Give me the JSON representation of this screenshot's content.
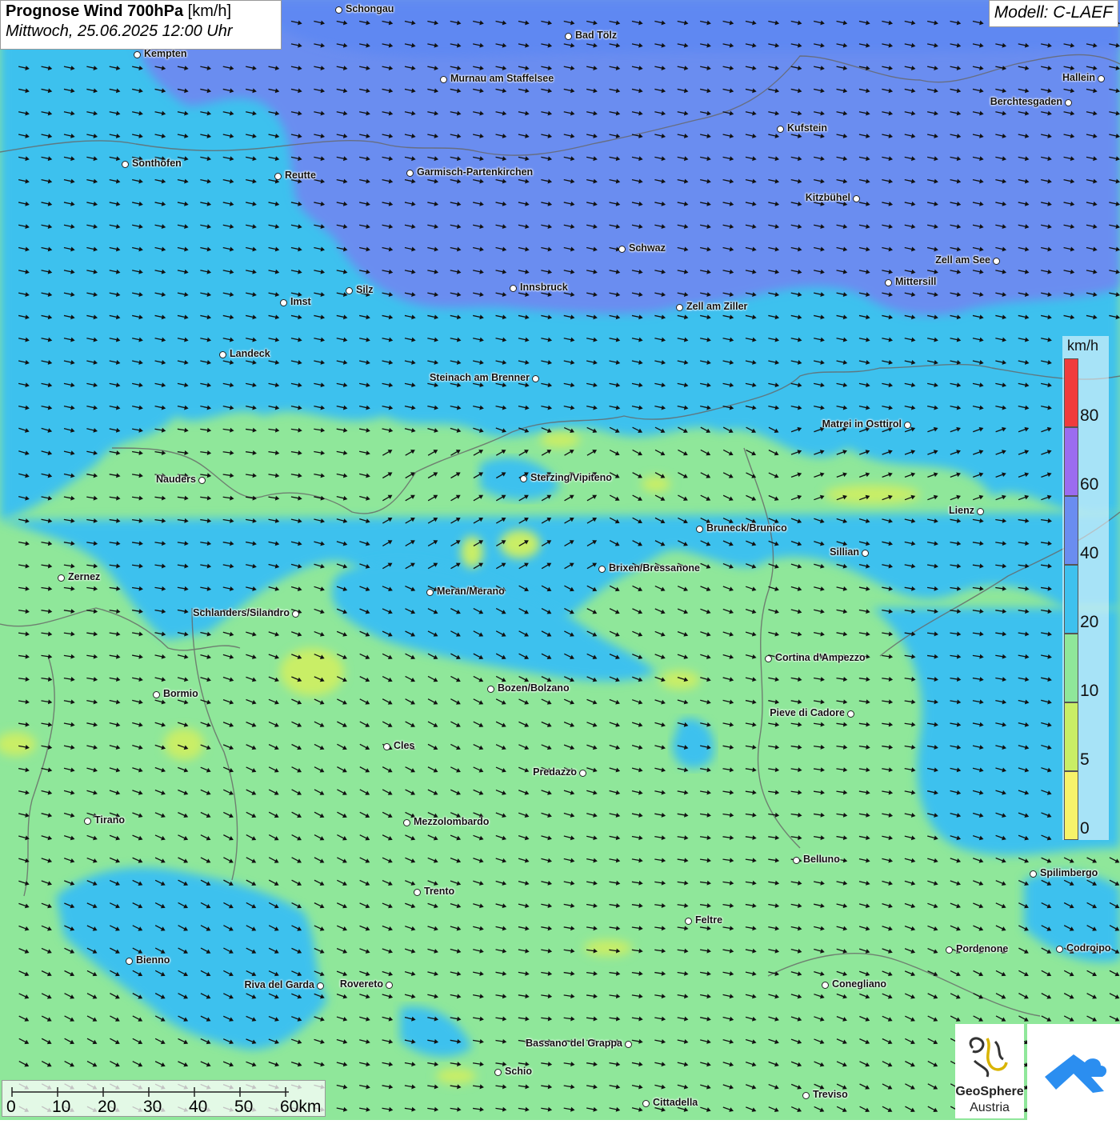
{
  "header": {
    "title_bold": "Prognose Wind 700hPa",
    "title_unit": "[km/h]",
    "datetime": "Mittwoch, 25.06.2025 12:00 Uhr",
    "model": "Modell: C-LAEF"
  },
  "legend": {
    "unit": "km/h",
    "bands": [
      {
        "label": "0",
        "color": "#f7f36a"
      },
      {
        "label": "5",
        "color": "#c9ee66"
      },
      {
        "label": "10",
        "color": "#8fe79a"
      },
      {
        "label": "20",
        "color": "#3ec1ee"
      },
      {
        "label": "40",
        "color": "#6a8df0"
      },
      {
        "label": "60",
        "color": "#9b6cf0"
      },
      {
        "label": "80",
        "color": "#f03c3c"
      }
    ]
  },
  "scale": {
    "labels": [
      "0",
      "10",
      "20",
      "30",
      "40",
      "50",
      "60km"
    ]
  },
  "logo": {
    "line1": "GeoSphere",
    "line2": "Austria"
  },
  "colors": {
    "wind_very_weak": "#c9ee66",
    "wind_weak": "#8fe79a",
    "wind_moderate": "#3ec1ee",
    "wind_strong": "#6a8df0",
    "border": "#666666"
  },
  "cities": [
    {
      "name": "Schongau"
    },
    {
      "name": "Bad Tölz"
    },
    {
      "name": "Kempten"
    },
    {
      "name": "Murnau am Staffelsee"
    },
    {
      "name": "Hallein"
    },
    {
      "name": "Berchtesgaden"
    },
    {
      "name": "Kufstein"
    },
    {
      "name": "Sonthofen"
    },
    {
      "name": "Reutte"
    },
    {
      "name": "Garmisch-Partenkirchen"
    },
    {
      "name": "Kitzbühel"
    },
    {
      "name": "Schwaz"
    },
    {
      "name": "Zell am See"
    },
    {
      "name": "Mittersill"
    },
    {
      "name": "Innsbruck"
    },
    {
      "name": "Silz"
    },
    {
      "name": "Imst"
    },
    {
      "name": "Zell am Ziller"
    },
    {
      "name": "Landeck"
    },
    {
      "name": "Steinach am Brenner"
    },
    {
      "name": "Matrei in Osttirol"
    },
    {
      "name": "Nauders"
    },
    {
      "name": "Sterzing/Vipiteno"
    },
    {
      "name": "Lienz"
    },
    {
      "name": "Bruneck/Brunico"
    },
    {
      "name": "Sillian"
    },
    {
      "name": "Brixen/Bressanone"
    },
    {
      "name": "Zernez"
    },
    {
      "name": "Meran/Merano"
    },
    {
      "name": "Schlanders/Silandro"
    },
    {
      "name": "Cortina d'Ampezzo"
    },
    {
      "name": "Bozen/Bolzano"
    },
    {
      "name": "Bormio"
    },
    {
      "name": "Pieve di Cadore"
    },
    {
      "name": "Cles"
    },
    {
      "name": "Predazzo"
    },
    {
      "name": "Tirano"
    },
    {
      "name": "Mezzolombardo"
    },
    {
      "name": "Belluno"
    },
    {
      "name": "Spilimbergo"
    },
    {
      "name": "Trento"
    },
    {
      "name": "Feltre"
    },
    {
      "name": "Bienno"
    },
    {
      "name": "Pordenone"
    },
    {
      "name": "Codroipo"
    },
    {
      "name": "Riva del Garda"
    },
    {
      "name": "Rovereto"
    },
    {
      "name": "Conegliano"
    },
    {
      "name": "Bassano del Grappa"
    },
    {
      "name": "Schio"
    },
    {
      "name": "Treviso"
    },
    {
      "name": "Cittadella"
    }
  ]
}
